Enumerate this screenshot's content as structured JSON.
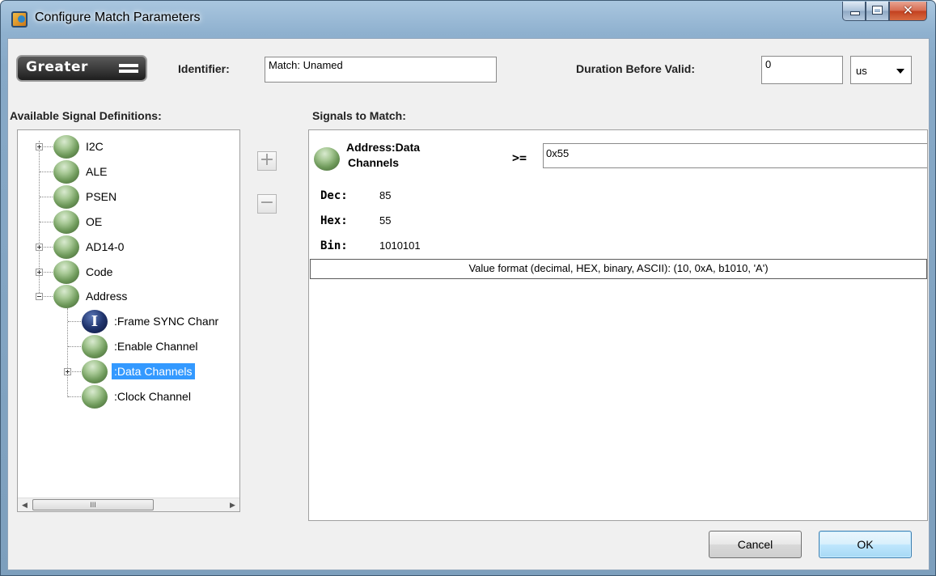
{
  "window": {
    "title": "Configure Match Parameters"
  },
  "brand": {
    "text": "Greater",
    "icon": "equals-icon"
  },
  "header": {
    "identifier_label": "Identifier:",
    "identifier_value": "Match: Unamed",
    "duration_label": "Duration Before Valid:",
    "duration_value": "0",
    "unit_value": "us"
  },
  "available": {
    "label": "Available Signal Definitions:",
    "items": [
      {
        "label": "I2C",
        "expandable": true,
        "expanded": false
      },
      {
        "label": "ALE",
        "expandable": false
      },
      {
        "label": "PSEN",
        "expandable": false
      },
      {
        "label": "OE",
        "expandable": false
      },
      {
        "label": "AD14-0",
        "expandable": true,
        "expanded": false
      },
      {
        "label": "Code",
        "expandable": true,
        "expanded": false
      },
      {
        "label": "Address",
        "expandable": true,
        "expanded": true,
        "children": [
          {
            "label": ":Frame SYNC Chanr",
            "icon": "info-icon"
          },
          {
            "label": ":Enable Channel"
          },
          {
            "label": ":Data Channels",
            "selected": true,
            "expandable": true
          },
          {
            "label": ":Clock Channel"
          }
        ]
      }
    ],
    "scrollbar_grip": "III"
  },
  "controls": {
    "add": "+",
    "remove": "−"
  },
  "match": {
    "label": "Signals to Match:",
    "signal_line1": "Address:Data",
    "signal_line2": "Channels",
    "operator": ">=",
    "value": "0x55",
    "dec_label": "Dec:",
    "dec_value": "85",
    "hex_label": "Hex:",
    "hex_value": "55",
    "bin_label": "Bin:",
    "bin_value": "1010101",
    "format_hint": "Value format (decimal, HEX, binary, ASCII):  (10, 0xA, b1010, 'A')"
  },
  "footer": {
    "cancel": "Cancel",
    "ok": "OK"
  },
  "colors": {
    "selection": "#3399ff",
    "accent": "#3c7fb1",
    "chrome": "#8fb1cf"
  }
}
